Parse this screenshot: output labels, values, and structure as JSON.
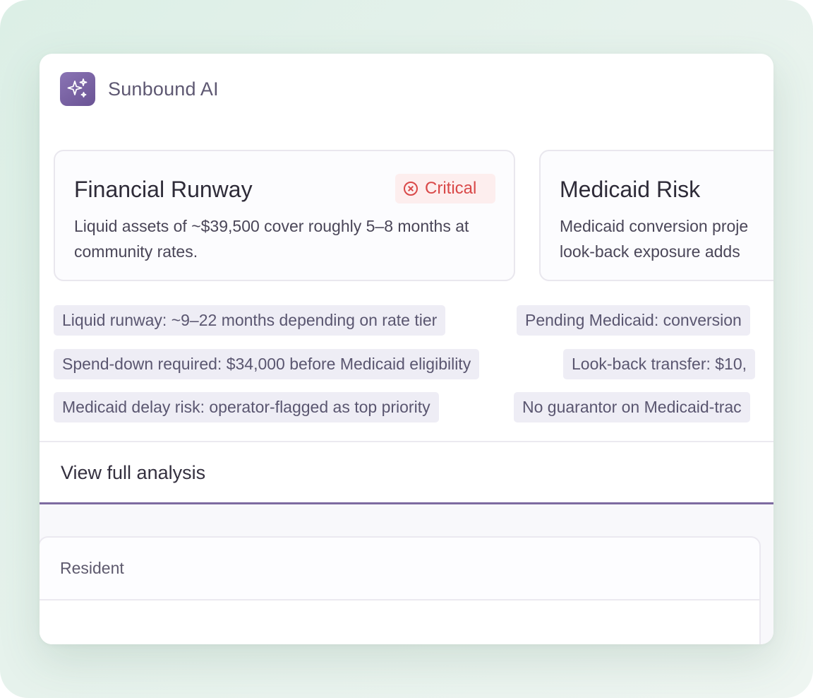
{
  "brand": {
    "name": "Sunbound AI",
    "icon": "sparkles-icon",
    "color": "#7a64a6"
  },
  "insights": [
    {
      "title": "Financial Runway",
      "badge": {
        "label": "Critical",
        "icon": "x-circle-icon",
        "color": "#d94848"
      },
      "text": "Liquid assets of ~$39,500 cover roughly 5–8 months at community rates."
    },
    {
      "title": "Medicaid Risk",
      "text_line1": "Medicaid conversion proje",
      "text_line2": "look-back exposure adds"
    }
  ],
  "chips": [
    "Liquid runway: ~9–22 months depending on rate tier",
    "Pending Medicaid: conversion",
    "Spend-down required: $34,000 before Medicaid eligibility",
    "Look-back transfer: $10,",
    "Medicaid delay risk: operator-flagged as top priority",
    "No guarantor on Medicaid-trac"
  ],
  "actions": {
    "view_full": "View full analysis"
  },
  "table": {
    "column_resident": "Resident"
  }
}
